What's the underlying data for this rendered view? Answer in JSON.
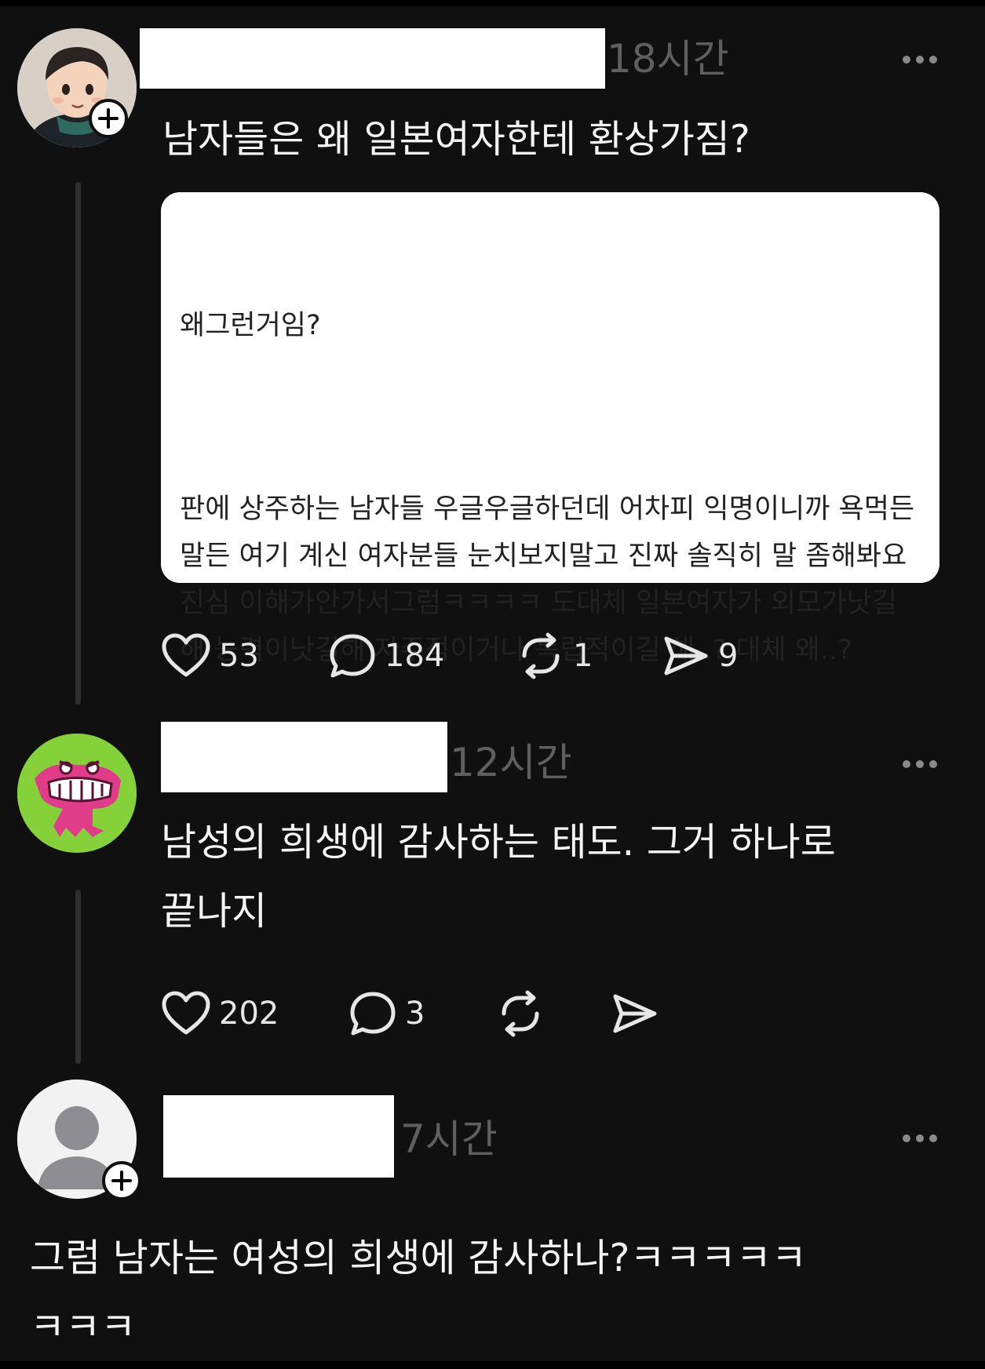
{
  "posts": [
    {
      "time": "18시간",
      "title": "남자들은 왜 일본여자한테 환상가짐?",
      "quote": {
        "line1": "왜그런거임?",
        "body": "판에 상주하는 남자들 우글우글하던데 어차피 익명이니까 욕먹든말든 여기 계신 여자분들 눈치보지말고 진짜 솔직히 말 좀해봐요 진심 이해가안가서그럼ㅋㅋㅋㅋ 도대체 일본여자가 외모가낫길해 능력이낫길해 자주적이거나 독립적이길 해..? 대체 왜..?"
      },
      "likes": "53",
      "comments": "184",
      "reposts": "1",
      "shares": "9",
      "avatar_icon": "cartoon-boy-avatar"
    },
    {
      "time": "12시간",
      "text": "남성의 희생에 감사하는 태도. 그거 하나로\n끝나지",
      "likes": "202",
      "comments": "3",
      "avatar_icon": "pink-crocodile-avatar"
    },
    {
      "time": "7시간",
      "text": "그럼 남자는 여성의 희생에 감사하나?ㅋㅋㅋㅋㅋ\nㅋㅋㅋ",
      "avatar_icon": "default-user-avatar"
    }
  ],
  "colors": {
    "background": "#101010",
    "text": "#f4f4f4",
    "muted": "#5f5f5f",
    "thread_line": "#2f2f2f"
  }
}
